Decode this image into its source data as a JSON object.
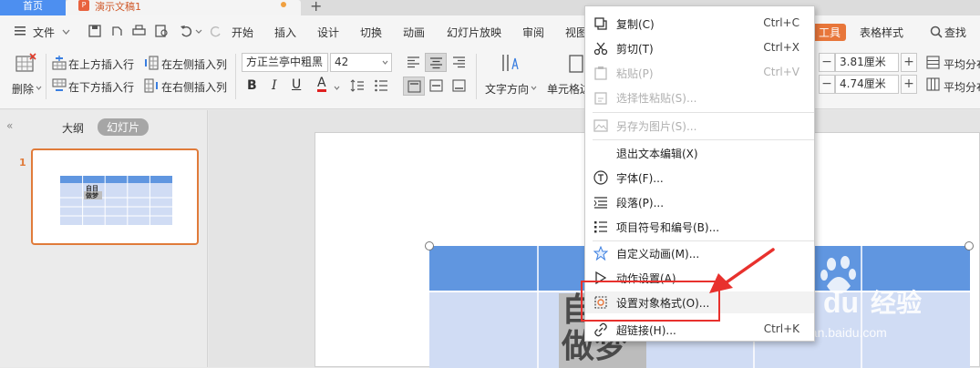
{
  "tabs": {
    "home": "首页",
    "doc": "演示文稿1",
    "plus": "+"
  },
  "menu": {
    "file": "文件",
    "items": [
      "开始",
      "插入",
      "设计",
      "切换",
      "动画",
      "幻灯片放映",
      "审阅",
      "视图"
    ],
    "table_tools": "工具",
    "table_style": "表格样式",
    "search": "查找"
  },
  "toolbar": {
    "insert_above": "在上方插入行",
    "insert_left": "在左侧插入列",
    "delete": "删除",
    "insert_below": "在下方插入行",
    "insert_right": "在右侧插入列",
    "font_name": "方正兰亭中粗黑",
    "font_size": "42",
    "text_direction": "文字方向",
    "cell_margin": "单元格边",
    "height_value": "3.81厘米",
    "width_value": "4.74厘米",
    "distribute_rows": "平均分布",
    "distribute_cols": "平均分布"
  },
  "panel": {
    "outline_tab": "大纲",
    "slides_tab": "幻灯片",
    "slide_number": "1",
    "thumb_text": "自目做梦"
  },
  "slide": {
    "cell_text_1": "自",
    "cell_text_2": "做梦"
  },
  "context_menu": [
    {
      "label": "复制(C)",
      "shortcut": "Ctrl+C",
      "icon": "copy-icon",
      "disabled": false
    },
    {
      "label": "剪切(T)",
      "shortcut": "Ctrl+X",
      "icon": "scissors-icon",
      "disabled": false
    },
    {
      "label": "粘贴(P)",
      "shortcut": "Ctrl+V",
      "icon": "paste-icon",
      "disabled": true
    },
    {
      "label": "选择性粘贴(S)...",
      "shortcut": "",
      "icon": "paste-special-icon",
      "disabled": true
    },
    {
      "label": "另存为图片(S)...",
      "shortcut": "",
      "icon": "image-icon",
      "disabled": true
    },
    {
      "label": "退出文本编辑(X)",
      "shortcut": "",
      "icon": "",
      "disabled": false
    },
    {
      "label": "字体(F)...",
      "shortcut": "",
      "icon": "font-icon",
      "disabled": false
    },
    {
      "label": "段落(P)...",
      "shortcut": "",
      "icon": "paragraph-icon",
      "disabled": false
    },
    {
      "label": "项目符号和编号(B)...",
      "shortcut": "",
      "icon": "bullets-icon",
      "disabled": false
    },
    {
      "label": "自定义动画(M)...",
      "shortcut": "",
      "icon": "star-icon",
      "disabled": false
    },
    {
      "label": "动作设置(A)...",
      "shortcut": "",
      "icon": "action-icon",
      "disabled": false
    },
    {
      "label": "设置对象格式(O)...",
      "shortcut": "",
      "icon": "format-object-icon",
      "disabled": false
    },
    {
      "label": "超链接(H)...",
      "shortcut": "Ctrl+K",
      "icon": "hyperlink-icon",
      "disabled": false
    }
  ],
  "watermark": {
    "brand": "Bai",
    "brand2": "du",
    "cn": "经验",
    "url": "jingyan.baidu.com"
  },
  "colors": {
    "accent": "#4d8ff0",
    "table_header": "#6096e0",
    "table_body": "#d0dcf4",
    "highlight": "#e8312d"
  }
}
